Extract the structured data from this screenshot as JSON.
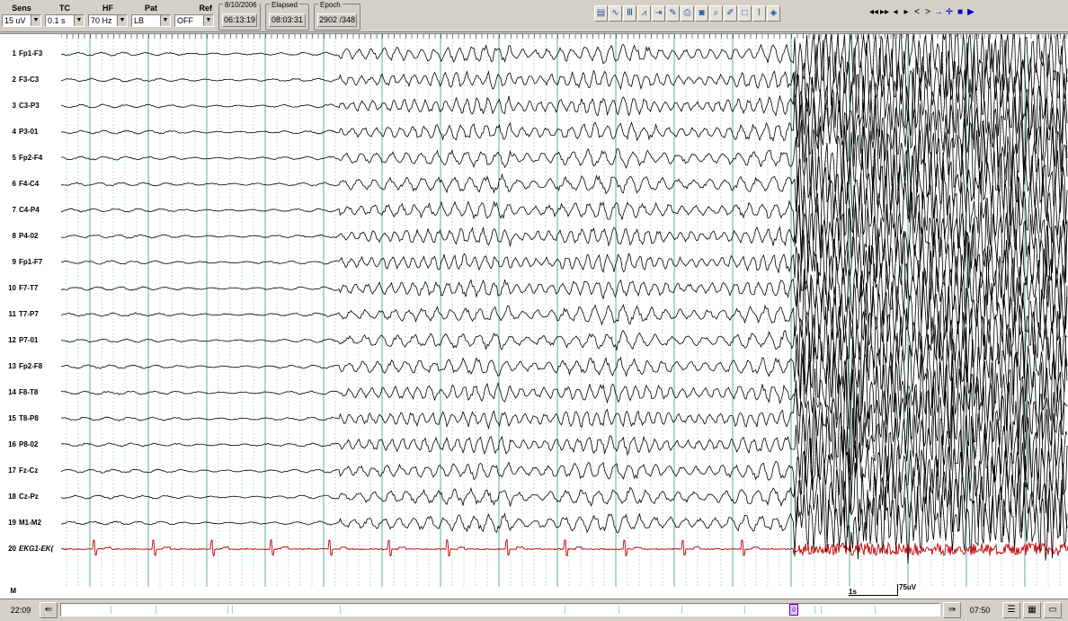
{
  "toolbar": {
    "controls": [
      {
        "label": "Sens",
        "value": "15 uV"
      },
      {
        "label": "TC",
        "value": "0.1 s"
      },
      {
        "label": "HF",
        "value": "70 Hz"
      },
      {
        "label": "Pat",
        "value": "LB"
      },
      {
        "label": "Ref",
        "value": "OFF"
      }
    ],
    "date": {
      "legend": "8/10/2006",
      "value": "06:13:19"
    },
    "elapsed": {
      "legend": "Elapsed",
      "value": "08:03:31"
    },
    "epoch": {
      "legend": "Epoch",
      "value": "2902 /348"
    },
    "tool_icons": [
      "montage-icon",
      "filter-icon",
      "channels-icon",
      "trend-icon",
      "marker-icon",
      "note-icon",
      "print-icon",
      "camera-icon",
      "zoom-icon",
      "pen-icon",
      "blank-icon",
      "spike-icon",
      "video-icon"
    ],
    "nav_buttons": [
      {
        "glyph": "◂◂",
        "name": "first-page-button"
      },
      {
        "glyph": "▸▸",
        "name": "next-fast-button"
      },
      {
        "glyph": "◂",
        "name": "prev-page-button"
      },
      {
        "glyph": "▸",
        "name": "next-page-button"
      },
      {
        "glyph": "<",
        "name": "prev-second-button"
      },
      {
        "glyph": ">",
        "name": "next-second-button"
      },
      {
        "glyph": "→",
        "name": "forward-button"
      },
      {
        "glyph": "✛",
        "name": "cursor-button"
      },
      {
        "glyph": "■",
        "name": "stop-button"
      },
      {
        "glyph": "▶",
        "name": "play-button"
      }
    ]
  },
  "channels": [
    {
      "num": "1",
      "name": "Fp1-F3"
    },
    {
      "num": "2",
      "name": "F3-C3"
    },
    {
      "num": "3",
      "name": "C3-P3"
    },
    {
      "num": "4",
      "name": "P3-01"
    },
    {
      "num": "5",
      "name": "Fp2-F4"
    },
    {
      "num": "6",
      "name": "F4-C4"
    },
    {
      "num": "7",
      "name": "C4-P4"
    },
    {
      "num": "8",
      "name": "P4-02"
    },
    {
      "num": "9",
      "name": "Fp1-F7"
    },
    {
      "num": "10",
      "name": "F7-T7"
    },
    {
      "num": "11",
      "name": "T7-P7"
    },
    {
      "num": "12",
      "name": "P7-01"
    },
    {
      "num": "13",
      "name": "Fp2-F8"
    },
    {
      "num": "14",
      "name": "F8-T8"
    },
    {
      "num": "15",
      "name": "T8-P8"
    },
    {
      "num": "16",
      "name": "P8-02"
    },
    {
      "num": "17",
      "name": "Fz-Cz"
    },
    {
      "num": "18",
      "name": "Cz-Pz"
    },
    {
      "num": "19",
      "name": "M1-M2"
    },
    {
      "num": "20",
      "name": "EKG1-EK("
    }
  ],
  "marker_label": "M",
  "scale": {
    "time": "1s",
    "amplitude": "75uV"
  },
  "colors": {
    "eeg_trace": "#000000",
    "ekg_trace": "#c00000",
    "grid_major": "#4aa8a0",
    "grid_minor": "#8cc8c8"
  },
  "bottom": {
    "start_time": "22:09",
    "end_time": "07:50"
  }
}
